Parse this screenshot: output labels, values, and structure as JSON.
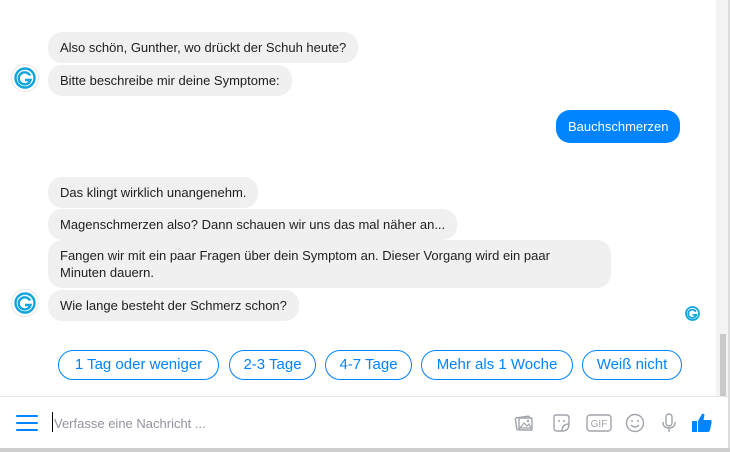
{
  "bot_messages_group1": [
    "Also schön, Gunther, wo drückt der Schuh heute?",
    "Bitte beschreibe mir deine Symptome:"
  ],
  "user_message": "Bauchschmerzen",
  "bot_messages_group2": [
    "Das klingt wirklich unangenehm.",
    "Magenschmerzen also? Dann schauen wir uns das mal näher an...",
    "Fangen wir mit ein paar Fragen über dein Symptom an. Dieser Vorgang wird ein paar Minuten dauern.",
    "Wie lange besteht der Schmerz schon?"
  ],
  "quick_replies": [
    "1 Tag oder weniger",
    "2-3 Tage",
    "4-7 Tage",
    "Mehr als 1 Woche",
    "Weiß nicht"
  ],
  "composer": {
    "placeholder": "Verfasse eine Nachricht ..."
  },
  "icons": {
    "menu": "hamburger-menu-icon",
    "image": "image-icon",
    "sticker": "sticker-icon",
    "gif": "gif-icon",
    "emoji": "emoji-icon",
    "mic": "microphone-icon",
    "like": "thumbs-up-icon",
    "gif_label": "GIF"
  },
  "colors": {
    "accent": "#0084ff",
    "bubble_bot": "#f1f0f0",
    "text": "#1c1e21"
  }
}
